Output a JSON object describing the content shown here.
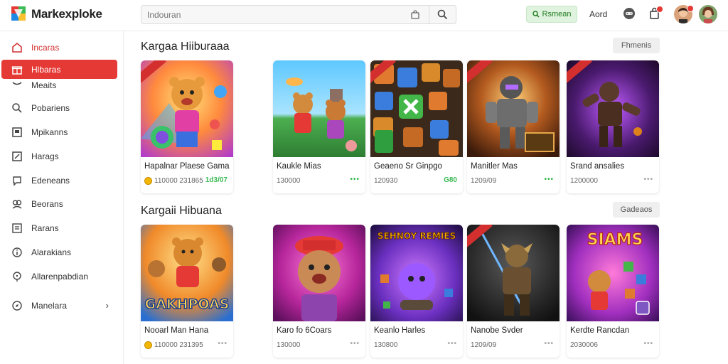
{
  "header": {
    "brand": "Markexploke",
    "search_placeholder": "Indouran",
    "green_button": "Rsmean",
    "link": "Aord"
  },
  "sidebar": {
    "items": [
      {
        "label": "Incaras",
        "icon": "home-icon"
      },
      {
        "label": "Hlbaras",
        "icon": "gift-icon"
      },
      {
        "label": "Meaits",
        "icon": "tag-icon"
      },
      {
        "label": "Pobariens",
        "icon": "search-icon"
      },
      {
        "label": "Mpikanns",
        "icon": "grid-icon"
      },
      {
        "label": "Harags",
        "icon": "edit-icon"
      },
      {
        "label": "Edeneans",
        "icon": "chat-icon"
      },
      {
        "label": "Beorans",
        "icon": "users-icon"
      },
      {
        "label": "Rarans",
        "icon": "list-icon"
      },
      {
        "label": "Alarakians",
        "icon": "info-icon"
      },
      {
        "label": "Allarenpabdian",
        "icon": "location-icon"
      },
      {
        "label": "Manelara",
        "icon": "compass-icon"
      }
    ]
  },
  "sections": [
    {
      "title": "Kargaa Hiiburaaa",
      "button": "Fhmenis",
      "cards": [
        {
          "name": "Hapalnar Plaese Gama",
          "meta": "110000  231865",
          "right": "1d3/07",
          "right_type": "green-text",
          "coin": true
        },
        {
          "name": "Kaukle Mias",
          "meta": "130000",
          "right": "•••",
          "right_type": "green-dots",
          "coin": false
        },
        {
          "name": "Geaeno Sr Ginpgo",
          "meta": "120930",
          "right": "G80",
          "right_type": "green-text",
          "coin": false
        },
        {
          "name": "Manitler Mas",
          "meta": "1209/09",
          "right": "•••",
          "right_type": "green-dots",
          "coin": false
        },
        {
          "name": "Srand ansalies",
          "meta": "1200000",
          "right": "•••",
          "right_type": "grey-dots",
          "coin": false
        }
      ]
    },
    {
      "title": "Kargaii Hibuana",
      "button": "Gadeaos",
      "cards": [
        {
          "name": "Nooarl Man Hana",
          "meta": "110000  231395",
          "right": "•••",
          "right_type": "grey-dots",
          "coin": true
        },
        {
          "name": "Karo fo 6Coars",
          "meta": "130000",
          "right": "•••",
          "right_type": "grey-dots",
          "coin": false
        },
        {
          "name": "Keanlo Harles",
          "meta": "130800",
          "right": "•••",
          "right_type": "grey-dots",
          "coin": false
        },
        {
          "name": "Nanobe Svder",
          "meta": "1209/09",
          "right": "•••",
          "right_type": "grey-dots",
          "coin": false
        },
        {
          "name": "Kerdte Rancdan",
          "meta": "2030006",
          "right": "•••",
          "right_type": "grey-dots",
          "coin": false
        }
      ]
    }
  ],
  "thumb_texts": {
    "row2_card1": "GAKHPOAS",
    "row2_card3": "SEHNOY REMIES",
    "row2_card5": "SIAMS"
  },
  "colors": {
    "accent": "#e53935",
    "green": "#3cba54"
  }
}
